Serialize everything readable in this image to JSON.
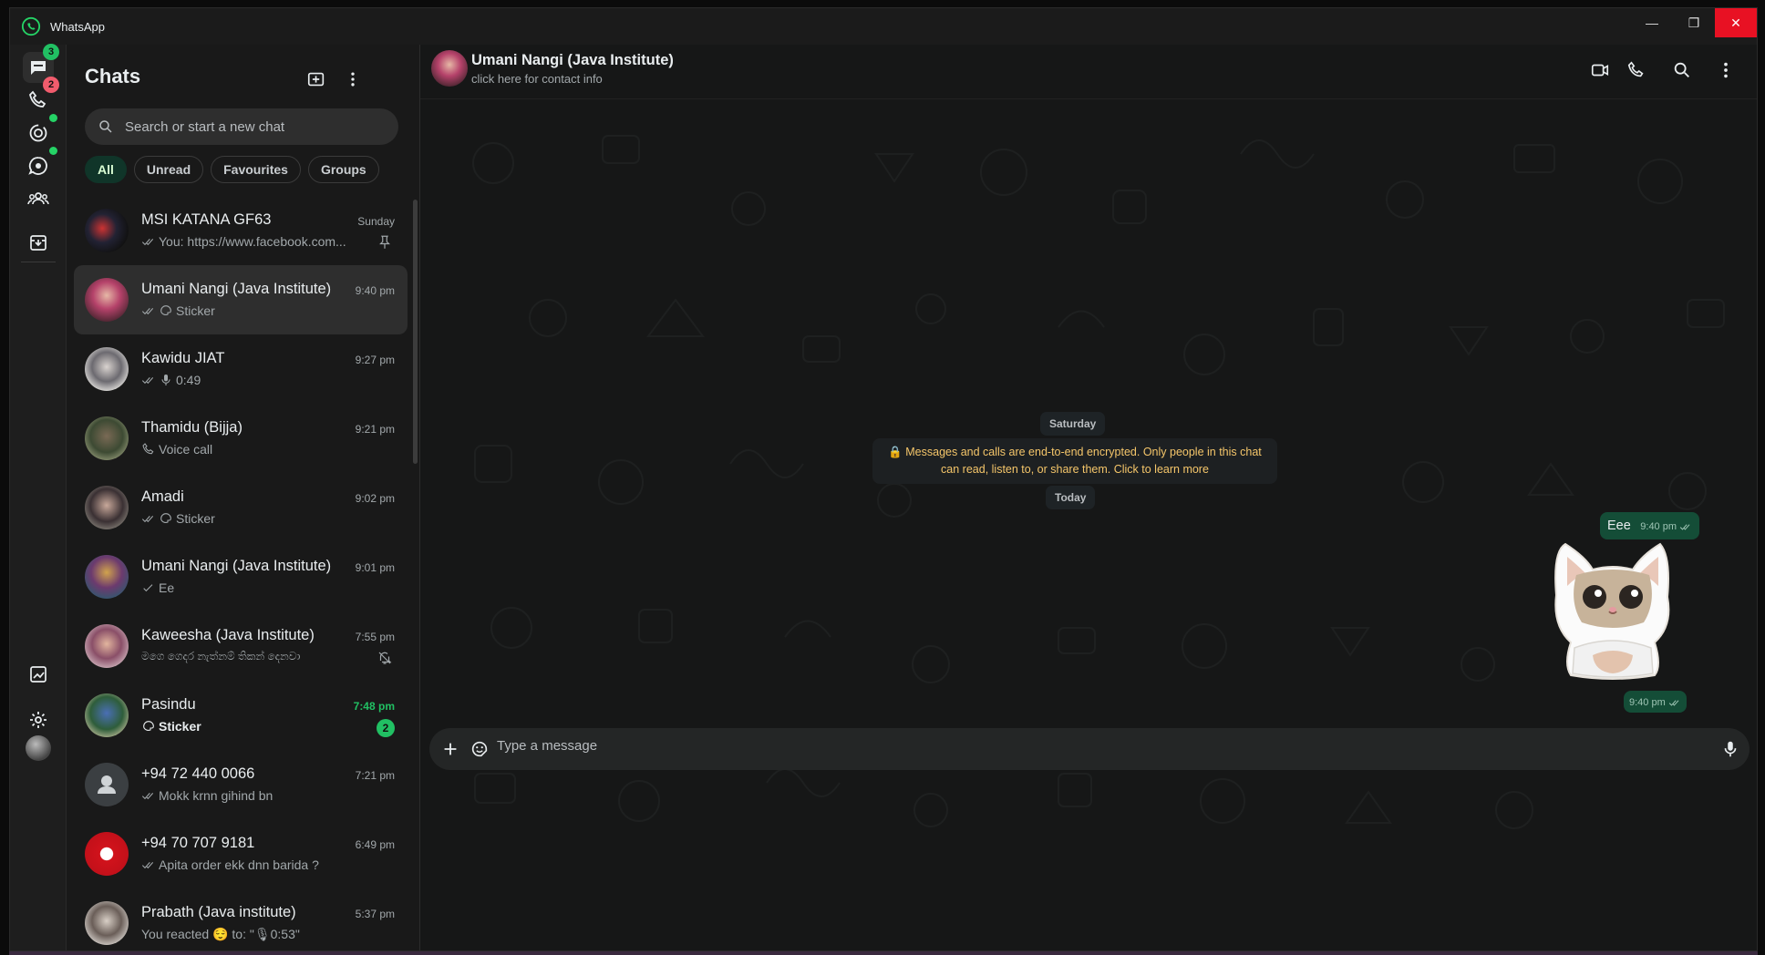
{
  "window": {
    "title": "WhatsApp",
    "minimize": "—",
    "restore": "❐",
    "close": "✕"
  },
  "rail": {
    "chats_badge": "3",
    "calls_badge": "2",
    "colors": {
      "badge": "#21c063",
      "calls_badge": "#f15c6d"
    }
  },
  "sidebar": {
    "title": "Chats",
    "search_placeholder": "Search or start a new chat",
    "filters": [
      "All",
      "Unread",
      "Favourites",
      "Groups"
    ],
    "chats": [
      {
        "name": "MSI KATANA GF63",
        "time": "Sunday",
        "preview": "You: https://www.facebook.com...",
        "status": "double-tick",
        "extra": "pin-icon"
      },
      {
        "name": "Umani Nangi (Java Institute)",
        "time": "9:40 pm",
        "preview": "Sticker",
        "status": "double-tick-sticker",
        "selected": true
      },
      {
        "name": "Kawidu JIAT",
        "time": "9:27 pm",
        "preview": "0:49",
        "status": "double-tick-mic"
      },
      {
        "name": "Thamidu (Bijja)",
        "time": "9:21 pm",
        "preview": "Voice call",
        "status": "call"
      },
      {
        "name": "Amadi",
        "time": "9:02 pm",
        "preview": "Sticker",
        "status": "double-tick-sticker"
      },
      {
        "name": "Umani Nangi (Java Institute)",
        "time": "9:01 pm",
        "preview": "Ee",
        "status": "single-tick"
      },
      {
        "name": "Kaweesha (Java Institute)",
        "time": "7:55 pm",
        "preview": "මගෙ ගෙදර නැත්නම් තිකන් දෙනවා",
        "status": "none",
        "extra": "muted-icon"
      },
      {
        "name": "Pasindu",
        "time": "7:48 pm",
        "preview": "Sticker",
        "status": "sticker",
        "unread": "2",
        "time_green": true
      },
      {
        "name": "+94 72 440 0066",
        "time": "7:21 pm",
        "preview": "Mokk krnn gihind bn",
        "status": "double-tick"
      },
      {
        "name": "+94 70 707 9181",
        "time": "6:49 pm",
        "preview": "Apita order ekk dnn barida ?",
        "status": "double-tick"
      },
      {
        "name": "Prabath (Java institute)",
        "time": "5:37 pm",
        "preview": "You reacted 😌 to: \"🎙0:53\"",
        "status": "none"
      }
    ]
  },
  "conversation": {
    "contact_name": "Umani Nangi (Java Institute)",
    "contact_sub": "click here for contact info",
    "day_saturday": "Saturday",
    "encryption_notice": "🔒 Messages and calls are end-to-end encrypted. Only people in this chat can read, listen to, or share them. Click to learn more",
    "day_today": "Today",
    "msg1_text": "Eee",
    "msg1_time": "9:40 pm",
    "sticker_time": "9:40 pm",
    "composer_placeholder": "Type a message"
  }
}
